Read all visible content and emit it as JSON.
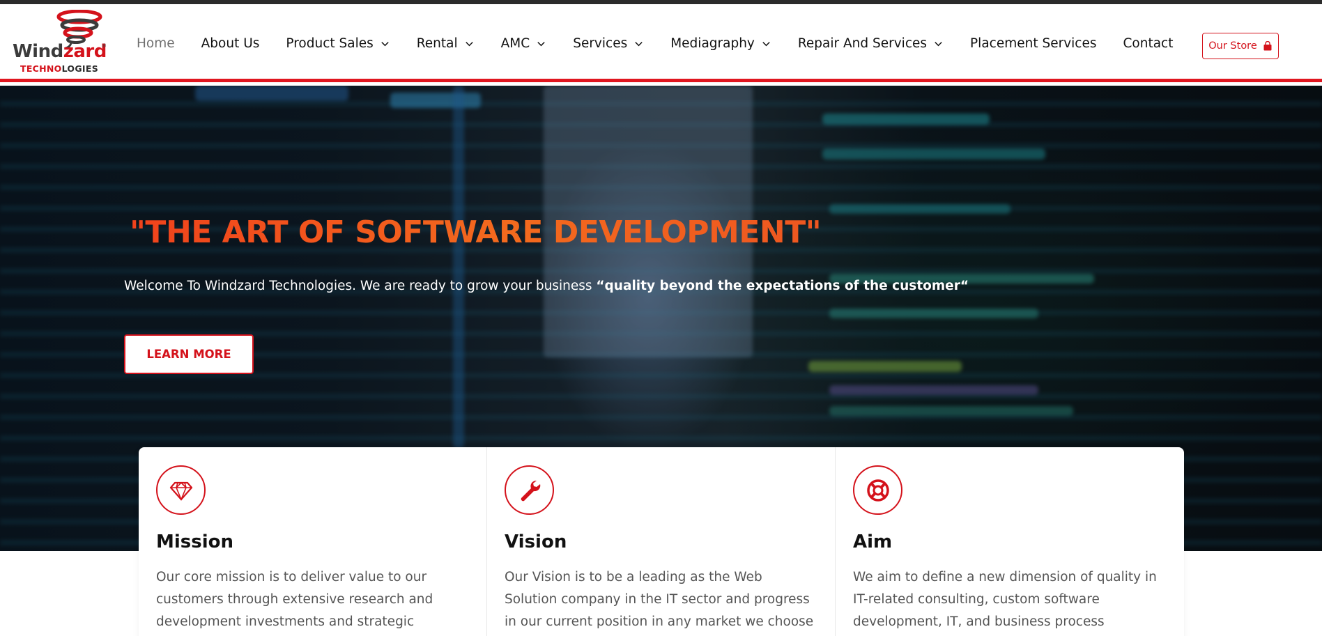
{
  "brand": {
    "logo_word_dark": "Wind",
    "logo_word_red": "zard",
    "logo_tech_red": "TECHNO",
    "logo_tech_dark": "LOGIES",
    "registered": "®",
    "accent_color": "#d4121b",
    "title_gradient": [
      "#f0421c",
      "#f36a1e"
    ]
  },
  "nav": {
    "items": [
      {
        "label": "Home",
        "active": true,
        "dropdown": false
      },
      {
        "label": "About Us",
        "dropdown": false
      },
      {
        "label": "Product Sales",
        "dropdown": true
      },
      {
        "label": "Rental",
        "dropdown": true
      },
      {
        "label": "AMC",
        "dropdown": true
      },
      {
        "label": "Services",
        "dropdown": true
      },
      {
        "label": "Mediagraphy",
        "dropdown": true
      },
      {
        "label": "Repair And Services",
        "dropdown": true
      },
      {
        "label": "Placement Services",
        "dropdown": false
      },
      {
        "label": "Contact",
        "dropdown": false
      }
    ],
    "store_label": "Our Store",
    "store_icon": "shopping-bag-icon"
  },
  "hero": {
    "title": "\"THE ART OF SOFTWARE DEVELOPMENT\"",
    "subtitle_plain": "Welcome To Windzard Technologies. We are ready to grow your business ",
    "subtitle_bold": "“quality beyond the expectations of the customer“",
    "cta_label": "LEARN MORE"
  },
  "cards": [
    {
      "icon": "diamond-icon",
      "title": "Mission",
      "text": "Our core mission is to deliver value to our customers through extensive research and development investments and strategic industry"
    },
    {
      "icon": "wrench-icon",
      "title": "Vision",
      "text": "Our Vision is to be a leading as the Web Solution company in the IT sector and progress in our current position in any market we choose to"
    },
    {
      "icon": "lifebuoy-icon",
      "title": "Aim",
      "text": "We aim to define a new dimension of quality in IT-related consulting, custom software development, IT, and business process outsourcing services. That"
    }
  ]
}
